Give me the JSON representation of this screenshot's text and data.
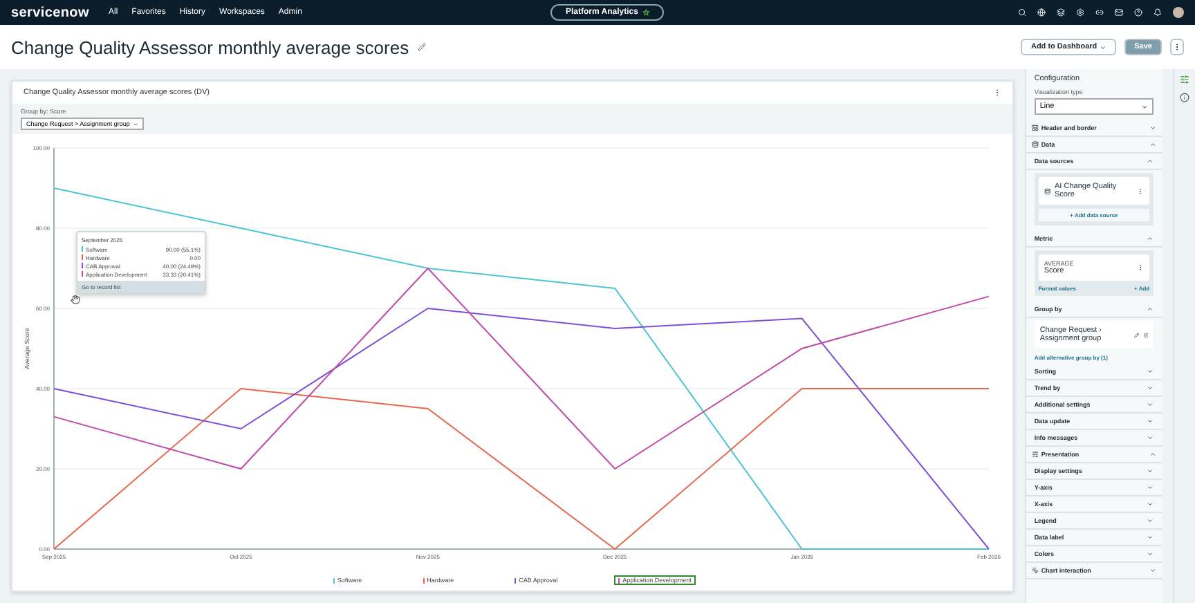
{
  "nav": {
    "logo": "servicenow",
    "links": [
      "All",
      "Favorites",
      "History",
      "Workspaces",
      "Admin"
    ],
    "center_pill": "Platform Analytics",
    "center_star": "☆"
  },
  "header": {
    "title": "Change Quality Assessor monthly average scores",
    "add_button": "Add to Dashboard",
    "save_button": "Save",
    "save_disabled": true
  },
  "card": {
    "title": "Change Quality Assessor monthly average scores (DV)",
    "group_by_label": "Group by: Score",
    "group_by_value": "Change Request > Assignment group",
    "tooltip": {
      "title": "September 2025",
      "rows": [
        {
          "name": "Software",
          "value": "90.00 (55.1%)",
          "color": "#4ec3d8"
        },
        {
          "name": "Hardware",
          "value": "0.00",
          "color": "#e8674a"
        },
        {
          "name": "CAB Approval",
          "value": "40.00 (24.49%)",
          "color": "#7b4fd6"
        },
        {
          "name": "Application Development",
          "value": "33.33 (20.41%)",
          "color": "#c04aa8"
        }
      ],
      "link": "Go to record list"
    },
    "chart_data": {
      "type": "line",
      "grid": true,
      "ylabel": "Average Score",
      "categories": [
        "Sep 2025",
        "Oct 2025",
        "Nov 2025",
        "Dec 2025",
        "Jan 2026",
        "Feb 2026"
      ],
      "ylim": [
        0,
        100
      ],
      "yticks": [
        {
          "value": 0,
          "label": "0.00"
        },
        {
          "value": 20,
          "label": "20.00"
        },
        {
          "value": 40,
          "label": "40.00"
        },
        {
          "value": 60,
          "label": "60.00"
        },
        {
          "value": 80,
          "label": "80.00"
        },
        {
          "value": 100,
          "label": "100.00"
        }
      ],
      "series": [
        {
          "name": "Software",
          "color": "#4ec3d8",
          "values": [
            90,
            80,
            70,
            65,
            0,
            0
          ]
        },
        {
          "name": "Hardware",
          "color": "#e8674a",
          "values": [
            0,
            40,
            35,
            0,
            40,
            40
          ]
        },
        {
          "name": "CAB Approval",
          "color": "#7b4fd6",
          "values": [
            40,
            30,
            60,
            55,
            57.5,
            0
          ]
        },
        {
          "name": "Application Development",
          "color": "#c04aa8",
          "values": [
            33,
            20,
            70,
            20,
            50,
            63
          ]
        }
      ]
    },
    "legend_selected": [
      false,
      false,
      false,
      true
    ]
  },
  "config": {
    "title": "Configuration",
    "viz_label": "Visualization type",
    "viz_value": "Line",
    "groups_top": [
      {
        "label": "Header and border",
        "expanded": false
      },
      {
        "label": "Data",
        "expanded": true
      }
    ],
    "data_sources": {
      "label": "Data sources",
      "expanded": true,
      "item": "AI Change Quality Score",
      "add": "+ Add data source"
    },
    "metric": {
      "label": "Metric",
      "expanded": true,
      "aggregate": "AVERAGE",
      "field": "Score",
      "format": "Format values",
      "add": "+ Add"
    },
    "group_by": {
      "label": "Group by",
      "expanded": true,
      "value": "Change Request › Assignment group",
      "alt": "Add alternative group by (1)"
    },
    "data_items": [
      {
        "label": "Sorting",
        "expanded": false
      },
      {
        "label": "Trend by",
        "expanded": false
      },
      {
        "label": "Additional settings",
        "expanded": false
      },
      {
        "label": "Data update",
        "expanded": false
      },
      {
        "label": "Info messages",
        "expanded": false
      }
    ],
    "presentation": {
      "label": "Presentation",
      "expanded": true
    },
    "presentation_items": [
      {
        "label": "Display settings",
        "expanded": false
      },
      {
        "label": "Y-axis",
        "expanded": false
      },
      {
        "label": "X-axis",
        "expanded": false
      },
      {
        "label": "Legend",
        "expanded": false
      },
      {
        "label": "Data label",
        "expanded": false
      },
      {
        "label": "Colors",
        "expanded": false
      }
    ],
    "interaction": {
      "label": "Chart interaction",
      "expanded": false
    }
  }
}
